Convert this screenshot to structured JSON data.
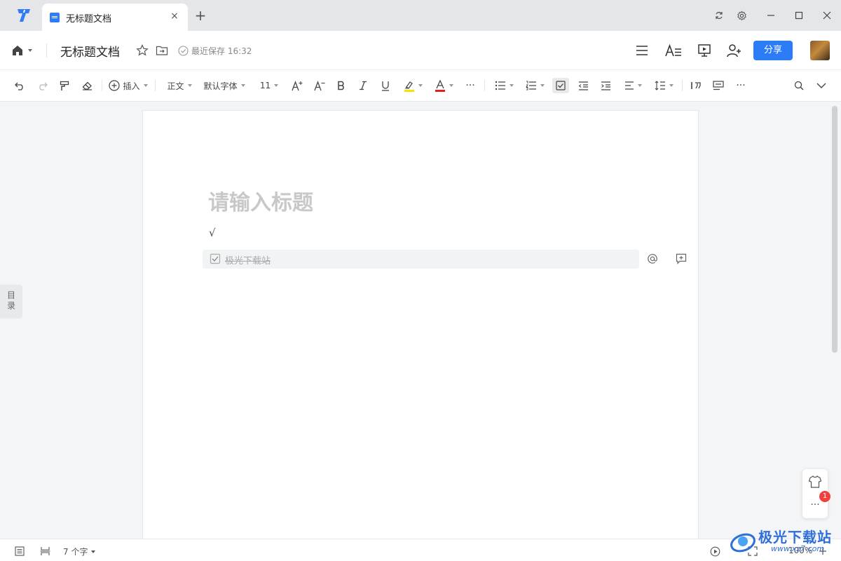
{
  "titlebar": {
    "tab_title": "无标题文档",
    "tab_close": "×",
    "new_tab": "+"
  },
  "header": {
    "doc_title": "无标题文档",
    "save_status": "最近保存 16:32",
    "share_label": "分享"
  },
  "toolbar": {
    "insert_label": "插入",
    "style_label": "正文",
    "font_label": "默认字体",
    "size_label": "11",
    "more": "···",
    "more2": "···"
  },
  "editor": {
    "title_placeholder": "请输入标题",
    "check_line": "√",
    "task_text": "极光下载站"
  },
  "toc_label_1": "目",
  "toc_label_2": "录",
  "float_panel": {
    "more": "...",
    "badge_count": "1"
  },
  "statusbar": {
    "word_count": "7 个字",
    "zoom": "100%"
  },
  "watermark": {
    "text": "极光下载站",
    "url": "www.xz7.com"
  },
  "colors": {
    "accent": "#2b7cf6",
    "highlight": "#f5e400",
    "font_color": "#e02020",
    "badge": "#f0413e"
  }
}
